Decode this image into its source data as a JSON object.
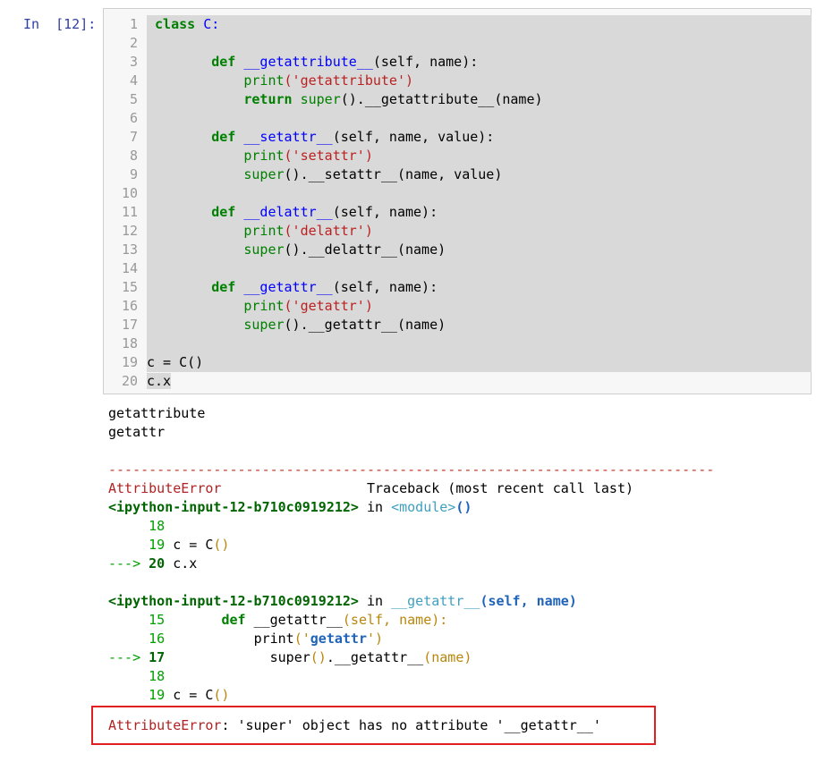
{
  "cell": {
    "prompt": "In  [12]:",
    "line_numbers": [
      "1",
      "2",
      "3",
      "4",
      "5",
      "6",
      "7",
      "8",
      "9",
      "10",
      "11",
      "12",
      "13",
      "14",
      "15",
      "16",
      "17",
      "18",
      "19",
      "20"
    ],
    "code": {
      "l1_kw": "class",
      "l1_name": " C:",
      "l3_kw": "def",
      "l3_fn": "__getattribute__",
      "l3_rest": "(self, name):",
      "l4_print": "print",
      "l4_str": "('getattribute')",
      "l5_kw": "return",
      "l5_super": "super",
      "l5_rest": "().__getattribute__(name)",
      "l7_kw": "def",
      "l7_fn": "__setattr__",
      "l7_rest": "(self, name, value):",
      "l8_print": "print",
      "l8_str": "('setattr')",
      "l9_super": "super",
      "l9_rest": "().__setattr__(name, value)",
      "l11_kw": "def",
      "l11_fn": "__delattr__",
      "l11_rest": "(self, name):",
      "l12_print": "print",
      "l12_str": "('delattr')",
      "l13_super": "super",
      "l13_rest": "().__delattr__(name)",
      "l15_kw": "def",
      "l15_fn": "__getattr__",
      "l15_rest": "(self, name):",
      "l16_print": "print",
      "l16_str": "('getattr')",
      "l17_super": "super",
      "l17_rest": "().__getattr__(name)",
      "l19": "c = C()",
      "l20": "c.x"
    }
  },
  "output": {
    "stdout1": "getattribute",
    "stdout2": "getattr",
    "separator": "---------------------------------------------------------------------------",
    "err_name": "AttributeError",
    "traceback_label": "Traceback (most recent call last)",
    "frame1_file": "<ipython-input-12-b710c0919212>",
    "in": " in ",
    "frame1_func": "<module>",
    "frame1_paren": "()",
    "f1_l18": "18",
    "f1_l19": "19",
    "f1_l19_code": " c = C",
    "f1_l19_paren": "()",
    "f1_arrow": "--->",
    "f1_l20": "20",
    "f1_l20_code": " c.x",
    "frame2_file": "<ipython-input-12-b710c0919212>",
    "frame2_func": "__getattr__",
    "frame2_args": "(self, name)",
    "f2_l15": "15",
    "f2_l15_kw": "def",
    "f2_l15_rest": " __getattr__",
    "f2_l15_args": "(self, name):",
    "f2_l16": "16",
    "f2_l16_print": "print",
    "f2_l16_paren_open": "('",
    "f2_l16_str": "getattr",
    "f2_l16_paren_close": "')",
    "f2_arrow": "--->",
    "f2_l17": "17",
    "f2_l17_super": "super",
    "f2_l17_paren": "()",
    "f2_l17_rest": ".__getattr__",
    "f2_l17_args": "(name)",
    "f2_l18": "18",
    "f2_l19": "19",
    "f2_l19_code": " c = C",
    "f2_l19_paren": "()",
    "final_name": "AttributeError",
    "final_msg": ": 'super' object has no attribute '__getattr__'"
  }
}
